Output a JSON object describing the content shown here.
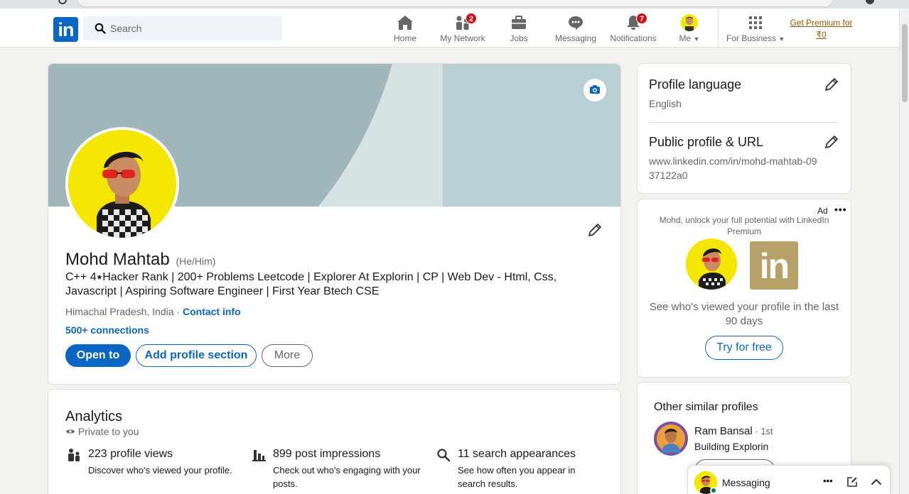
{
  "nav": {
    "search_placeholder": "Search",
    "items": [
      {
        "label": "Home",
        "icon": "home-icon"
      },
      {
        "label": "My Network",
        "icon": "network-icon",
        "badge": "2"
      },
      {
        "label": "Jobs",
        "icon": "briefcase-icon"
      },
      {
        "label": "Messaging",
        "icon": "messaging-icon"
      },
      {
        "label": "Notifications",
        "icon": "bell-icon",
        "badge": "7"
      },
      {
        "label": "Me",
        "icon": "avatar"
      },
      {
        "label": "For Business",
        "icon": "grid-icon"
      }
    ],
    "premium_line1": "Get Premium for",
    "premium_line2": "₹0"
  },
  "profile": {
    "name": "Mohd Mahtab",
    "pronouns": "(He/Him)",
    "headline": "C++ 4⭑Hacker Rank | 200+ Problems Leetcode | Explorer At Explorin | CP | Web Dev - Html, Css, Javascript | Aspiring Software Engineer | First Year Btech CSE",
    "location": "Himachal Pradesh, India",
    "location_sep": " · ",
    "contact_info": "Contact info",
    "connections": "500+ connections",
    "btn_open_to": "Open to",
    "btn_add_section": "Add profile section",
    "btn_more": "More"
  },
  "analytics": {
    "title": "Analytics",
    "private": "Private to you",
    "items": [
      {
        "head": "223 profile views",
        "desc": "Discover who's viewed your profile.",
        "icon": "people-icon"
      },
      {
        "head": "899 post impressions",
        "desc": "Check out who's engaging with your posts.",
        "icon": "bar-chart-icon"
      },
      {
        "head": "11 search appearances",
        "desc": "See how often you appear in search results.",
        "icon": "search-icon"
      }
    ]
  },
  "sidebar": {
    "profile_language_title": "Profile language",
    "profile_language_value": "English",
    "public_profile_title": "Public profile & URL",
    "public_profile_url": "www.linkedin.com/in/mohd-mahtab-0937122a0"
  },
  "ad": {
    "label": "Ad",
    "more": "•••",
    "text": "Mohd, unlock your full potential with LinkedIn Premium",
    "cta_text": "See who's viewed your profile in the last 90 days",
    "button": "Try for free",
    "logo_text": "in"
  },
  "similar": {
    "title": "Other similar profiles",
    "name": "Ram Bansal",
    "degree": " · 1st",
    "headline": "Building Explorin"
  },
  "messaging": {
    "label": "Messaging",
    "more": "•••"
  },
  "colors": {
    "brand": "#0a66c2",
    "badge": "#cc1016",
    "premium": "#915907",
    "background": "#f3f2ef"
  }
}
